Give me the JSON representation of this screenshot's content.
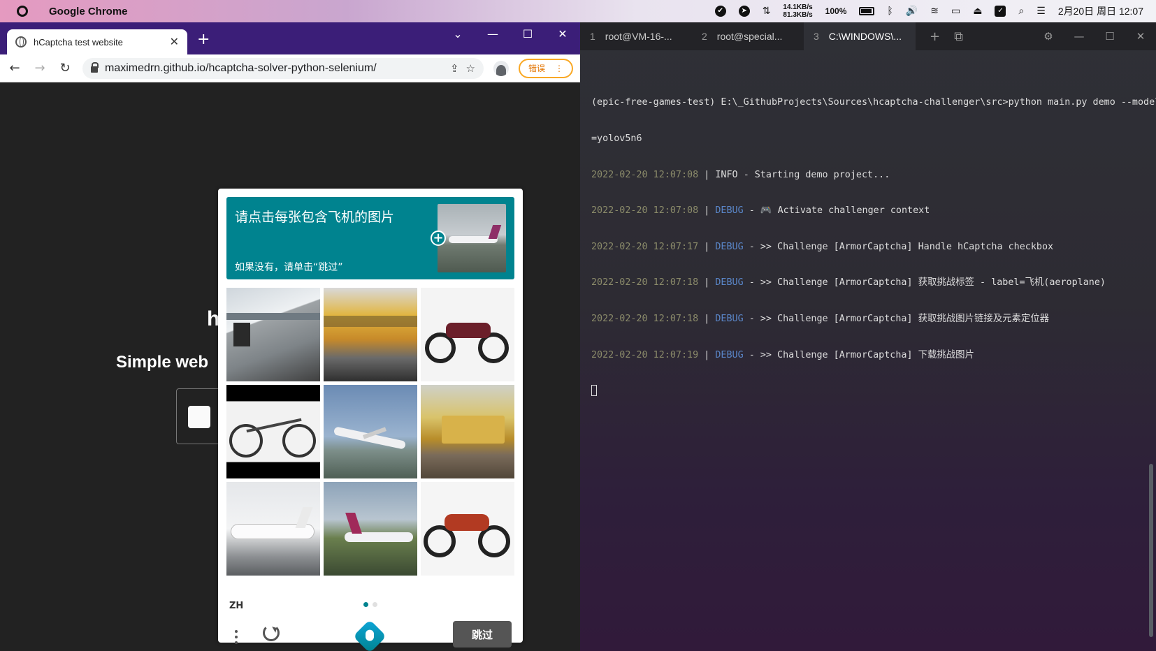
{
  "menubar": {
    "app_name": "Google Chrome",
    "net_up": "14.1KB/s",
    "net_down": "81.3KB/s",
    "battery": "100%",
    "clock": "2月20日 周日 12:07"
  },
  "chrome": {
    "tab_title": "hCaptcha test website",
    "url": "maximedrn.github.io/hcaptcha-solver-python-selenium/",
    "error_label": "错误"
  },
  "page": {
    "heading": "h",
    "subheading": "Simple web"
  },
  "challenge": {
    "prompt": "请点击每张包含飞机的图片",
    "subprompt": "如果没有，请单击“跳过”",
    "language": "ZH",
    "skip_label": "跳过",
    "tiles": [
      "train",
      "train",
      "motorcycle",
      "bicycle",
      "airplane",
      "train",
      "airplane",
      "airplane",
      "motorcycle"
    ]
  },
  "terminal": {
    "tabs": [
      {
        "num": "1",
        "label": "root@VM-16-..."
      },
      {
        "num": "2",
        "label": "root@special..."
      },
      {
        "num": "3",
        "label": "C:\\WINDOWS\\..."
      }
    ],
    "command_line1": "(epic-free-games-test) E:\\_GithubProjects\\Sources\\hcaptcha-challenger\\src>python main.py demo --model",
    "command_line2": "=yolov5n6",
    "logs": [
      {
        "ts": "2022-02-20 12:07:08",
        "level": "INFO",
        "msg": "- Starting demo project..."
      },
      {
        "ts": "2022-02-20 12:07:08",
        "level": "DEBUG",
        "msg": "- 🎮 Activate challenger context"
      },
      {
        "ts": "2022-02-20 12:07:17",
        "level": "DEBUG",
        "msg": "- >> Challenge [ArmorCaptcha] Handle hCaptcha checkbox"
      },
      {
        "ts": "2022-02-20 12:07:18",
        "level": "DEBUG",
        "msg": "- >> Challenge [ArmorCaptcha] 获取挑战标签 - label=飞机(aeroplane)"
      },
      {
        "ts": "2022-02-20 12:07:18",
        "level": "DEBUG",
        "msg": "- >> Challenge [ArmorCaptcha] 获取挑战图片链接及元素定位器"
      },
      {
        "ts": "2022-02-20 12:07:19",
        "level": "DEBUG",
        "msg": "- >> Challenge [ArmorCaptcha] 下载挑战图片"
      }
    ]
  }
}
